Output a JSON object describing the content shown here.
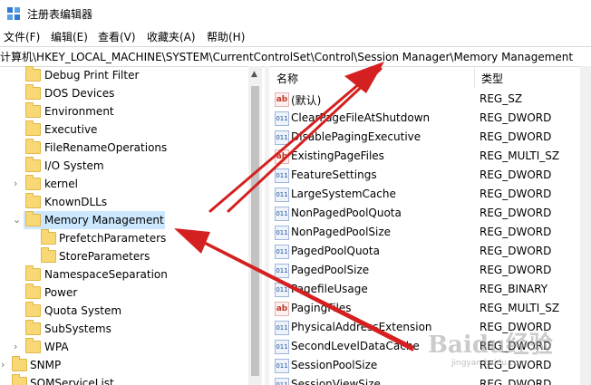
{
  "window": {
    "title": "注册表编辑器"
  },
  "menu": [
    "文件(F)",
    "编辑(E)",
    "查看(V)",
    "收藏夹(A)",
    "帮助(H)"
  ],
  "address": "计算机\\HKEY_LOCAL_MACHINE\\SYSTEM\\CurrentControlSet\\Control\\Session Manager\\Memory Management",
  "tree": [
    {
      "label": "Debug Print Filter",
      "expander": ""
    },
    {
      "label": "DOS Devices",
      "expander": ""
    },
    {
      "label": "Environment",
      "expander": ""
    },
    {
      "label": "Executive",
      "expander": ""
    },
    {
      "label": "FileRenameOperations",
      "expander": ""
    },
    {
      "label": "I/O System",
      "expander": ""
    },
    {
      "label": "kernel",
      "expander": ">"
    },
    {
      "label": "KnownDLLs",
      "expander": ""
    },
    {
      "label": "Memory Management",
      "expander": "v",
      "selected": true
    },
    {
      "label": "PrefetchParameters",
      "expander": ""
    },
    {
      "label": "StoreParameters",
      "expander": ""
    },
    {
      "label": "NamespaceSeparation",
      "expander": ""
    },
    {
      "label": "Power",
      "expander": ""
    },
    {
      "label": "Quota System",
      "expander": ""
    },
    {
      "label": "SubSystems",
      "expander": ""
    },
    {
      "label": "WPA",
      "expander": ">"
    },
    {
      "label": "SNMP",
      "expander": ">"
    },
    {
      "label": "SOMServiceList",
      "expander": ""
    }
  ],
  "columns": {
    "name": "名称",
    "type": "类型"
  },
  "values": [
    {
      "name": "(默认)",
      "type": "REG_SZ",
      "icon": "string"
    },
    {
      "name": "ClearPageFileAtShutdown",
      "type": "REG_DWORD",
      "icon": "binary"
    },
    {
      "name": "DisablePagingExecutive",
      "type": "REG_DWORD",
      "icon": "binary"
    },
    {
      "name": "ExistingPageFiles",
      "type": "REG_MULTI_SZ",
      "icon": "string"
    },
    {
      "name": "FeatureSettings",
      "type": "REG_DWORD",
      "icon": "binary"
    },
    {
      "name": "LargeSystemCache",
      "type": "REG_DWORD",
      "icon": "binary"
    },
    {
      "name": "NonPagedPoolQuota",
      "type": "REG_DWORD",
      "icon": "binary"
    },
    {
      "name": "NonPagedPoolSize",
      "type": "REG_DWORD",
      "icon": "binary"
    },
    {
      "name": "PagedPoolQuota",
      "type": "REG_DWORD",
      "icon": "binary"
    },
    {
      "name": "PagedPoolSize",
      "type": "REG_DWORD",
      "icon": "binary"
    },
    {
      "name": "PagefileUsage",
      "type": "REG_BINARY",
      "icon": "binary"
    },
    {
      "name": "PagingFiles",
      "type": "REG_MULTI_SZ",
      "icon": "string"
    },
    {
      "name": "PhysicalAddressExtension",
      "type": "REG_DWORD",
      "icon": "binary"
    },
    {
      "name": "SecondLevelDataCache",
      "type": "REG_DWORD",
      "icon": "binary"
    },
    {
      "name": "SessionPoolSize",
      "type": "REG_DWORD",
      "icon": "binary"
    },
    {
      "name": "SessionViewSize",
      "type": "REG_DWORD",
      "icon": "binary"
    }
  ],
  "watermark": {
    "text": "Baidu经验",
    "sub": "jingyan.baidu.com"
  },
  "annotation_color": "#d42020"
}
